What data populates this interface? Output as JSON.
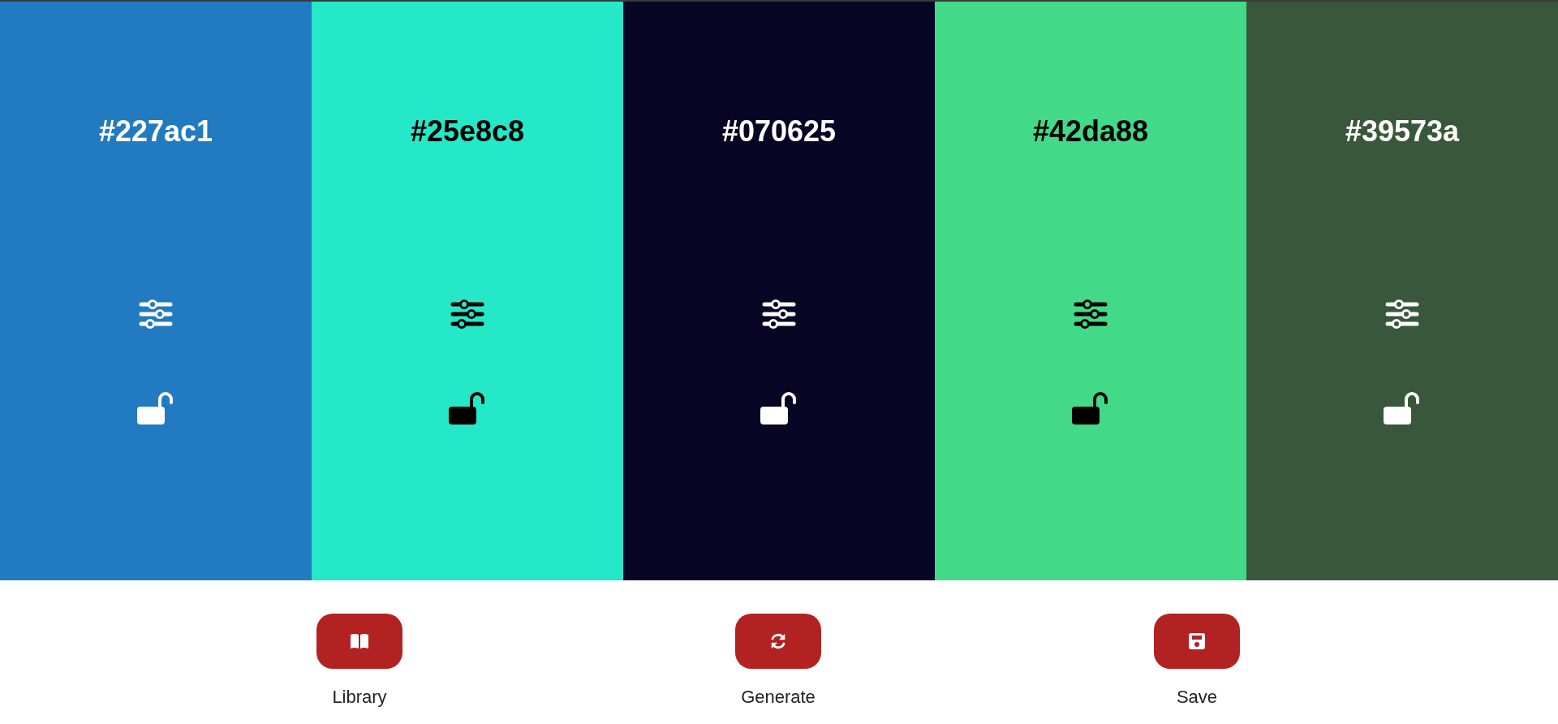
{
  "palette": [
    {
      "hex": "#227ac1",
      "color": "#227ac1",
      "dark_text": false,
      "locked": false
    },
    {
      "hex": "#25e8c8",
      "color": "#25e8c8",
      "dark_text": true,
      "locked": false
    },
    {
      "hex": "#070625",
      "color": "#070625",
      "dark_text": false,
      "locked": false
    },
    {
      "hex": "#42da88",
      "color": "#42da88",
      "dark_text": true,
      "locked": false
    },
    {
      "hex": "#39573a",
      "color": "#39573a",
      "dark_text": false,
      "locked": false
    }
  ],
  "actions": [
    {
      "kind": "library",
      "label": "Library"
    },
    {
      "kind": "generate",
      "label": "Generate"
    },
    {
      "kind": "save",
      "label": "Save"
    }
  ]
}
